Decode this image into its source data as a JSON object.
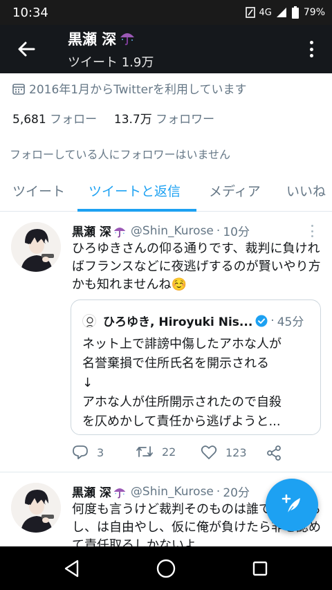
{
  "status_bar": {
    "time": "10:34",
    "network": "4G",
    "battery": "79%"
  },
  "header": {
    "name": "黒瀬 深",
    "tweet_count": "ツイート 1.9万"
  },
  "profile": {
    "joined": "2016年1月からTwitterを利用しています",
    "following_count": "5,681",
    "following_label": "フォロー",
    "followers_count": "13.7万",
    "followers_label": "フォロワー",
    "mutual_note": "フォローしている人にフォロワーはいません"
  },
  "tabs": [
    {
      "label": "ツイート",
      "active": false
    },
    {
      "label": "ツイートと返信",
      "active": true
    },
    {
      "label": "メディア",
      "active": false
    },
    {
      "label": "いいね",
      "active": false
    }
  ],
  "tweets": [
    {
      "name": "黒瀬 深",
      "handle": "@Shin_Kurose",
      "separator": "·",
      "time": "10分",
      "text": "ひろゆきさんの仰る通りです、裁判に負ければフランスなどに夜逃げするのが賢いやり方かも知れませんね☺️",
      "quote": {
        "name": "ひろゆき, Hiroyuki Nis...",
        "separator": "·",
        "time": "45分",
        "text": "ネット上で誹謗中傷したアホな人が\n名誉棄損で住所氏名を開示される\n↓\nアホな人が住所開示されたので自殺\nを仄めかして責任から逃げようと..."
      },
      "replies": "3",
      "retweets": "22",
      "likes": "123"
    },
    {
      "name": "黒瀬 深",
      "handle": "@Shin_Kurose",
      "separator": "·",
      "time": "20分",
      "text": "何度も言うけど裁判そのものは誰でも出来るし、は自由やし、仮に俺が負けたら非を認めて責任取るしかないよ"
    }
  ],
  "colors": {
    "accent": "#1da1f2",
    "header_bg": "#15181c",
    "muted_text": "#657786"
  },
  "icons": {
    "back": "arrow-left-icon",
    "more": "more-vertical-icon",
    "calendar": "calendar-icon",
    "reply": "reply-icon",
    "retweet": "retweet-icon",
    "like": "heart-icon",
    "share": "share-icon",
    "compose": "compose-icon",
    "verified": "verified-badge-icon",
    "umbrella": "umbrella-emoji-icon"
  }
}
